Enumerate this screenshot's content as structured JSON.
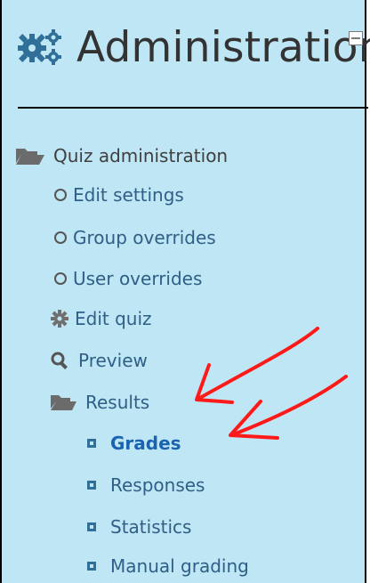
{
  "header": {
    "title": "Administration",
    "icon": "gear-icon",
    "collapse_icon": "collapse-icon"
  },
  "tree": {
    "root": {
      "label": "Quiz administration",
      "icon": "folder-open-icon"
    },
    "items": [
      {
        "label": "Edit settings",
        "icon": "circle-icon"
      },
      {
        "label": "Group overrides",
        "icon": "circle-icon"
      },
      {
        "label": "User overrides",
        "icon": "circle-icon"
      },
      {
        "label": "Edit quiz",
        "icon": "cog-icon"
      },
      {
        "label": "Preview",
        "icon": "magnifier-icon"
      },
      {
        "label": "Results",
        "icon": "folder-open-icon"
      }
    ],
    "results_children": [
      {
        "label": "Grades",
        "icon": "square-bullet-icon",
        "current": true
      },
      {
        "label": "Responses",
        "icon": "square-bullet-icon"
      },
      {
        "label": "Statistics",
        "icon": "square-bullet-icon"
      },
      {
        "label": "Manual grading",
        "icon": "square-bullet-icon"
      }
    ]
  },
  "colors": {
    "panel_bg": "#bfe6f5",
    "link": "#2f5f86",
    "current": "#1a63b0",
    "annotation_arrow": "#ff0000"
  }
}
